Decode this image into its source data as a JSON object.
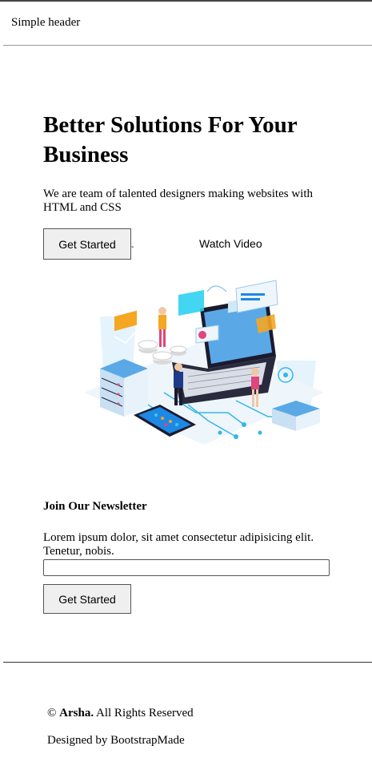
{
  "header": {
    "title": "Simple header"
  },
  "hero": {
    "title": "Better Solutions For Your Business",
    "subtitle": "We are team of talented designers making websites with HTML and CSS",
    "primary_button": "Get Started",
    "separator": "-",
    "secondary_link": "Watch Video"
  },
  "newsletter": {
    "title": "Join Our Newsletter",
    "text": "Lorem ipsum dolor, sit amet consectetur adipisicing elit. Tenetur, nobis.",
    "input_value": "",
    "button": "Get Started"
  },
  "footer": {
    "copyright_prefix": "©",
    "brand": "Arsha.",
    "copyright_suffix": "All Rights Reserved",
    "credits": "Designed by BootstrapMade"
  },
  "colors": {
    "accent_blue": "#1e88e5",
    "light_blue": "#cfe9fb",
    "dark": "#1b1b2f",
    "orange": "#f5a623",
    "pink": "#e0457b"
  }
}
